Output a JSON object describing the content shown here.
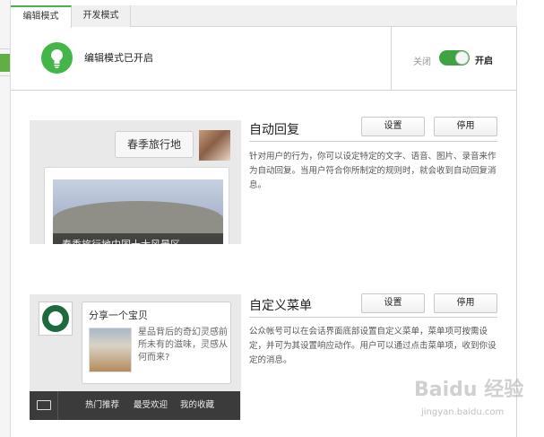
{
  "tabs": [
    {
      "label": "编辑模式",
      "active": true
    },
    {
      "label": "开发模式",
      "active": false
    }
  ],
  "status": {
    "text": "编辑模式已开启",
    "toggle_off_label": "关闭",
    "toggle_on_label": "开启",
    "toggle_state": "on",
    "icon": "lightbulb-icon"
  },
  "features": [
    {
      "title": "自动回复",
      "settings_label": "设置",
      "disable_label": "停用",
      "description": "针对用户的行为，你可以设定特定的文字、语音、图片、录音来作为自动回复。当用户符合你所制定的规则时，就会收到自动回复消息。",
      "preview": {
        "bubble_text": "春季旅行地",
        "caption": "春季旅行地中国十大风景区"
      }
    },
    {
      "title": "自定义菜单",
      "settings_label": "设置",
      "disable_label": "停用",
      "description": "公众帐号可以在会话界面底部设置自定义菜单，菜单项可按需设定，并可为其设置响应动作。用户可以通过点击菜单项，收到你设定的消息。",
      "preview": {
        "share_title": "分享一个宝贝",
        "share_desc": "星品背后的奇幻灵感前所未有的滋味，灵感从何而来?",
        "menu_items": [
          "热门推荐",
          "最受欢迎",
          "我的收藏"
        ]
      }
    }
  ],
  "watermark": {
    "logo": "Baidu 经验",
    "sub": "jingyan.baidu.com"
  },
  "colors": {
    "accent_green": "#44b549",
    "toggle_green": "#3fa343"
  }
}
